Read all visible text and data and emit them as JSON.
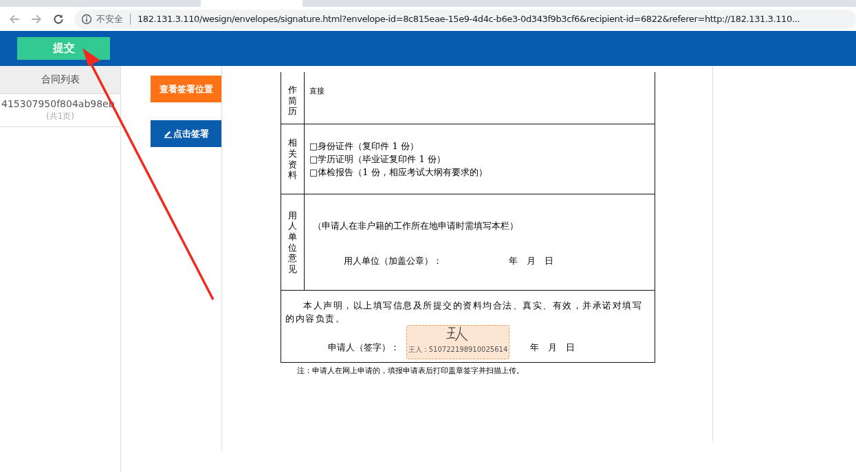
{
  "browser": {
    "security_label": "不安全",
    "url": "182.131.3.110/wesign/envelopes/signature.html?envelope-id=8c815eae-15e9-4d4c-b6e3-0d343f9b3cf6&recipient-id=6822&referer=http://182.131.3.110..."
  },
  "header": {
    "submit_button": "提交"
  },
  "sidebar": {
    "title": "合同列表",
    "items": [
      {
        "name": "415307950f804ab98eb",
        "pages": "(共1页)",
        "selected": false
      }
    ]
  },
  "actions": {
    "view_position_button": "查看签署位置",
    "sign_button": "点击签署"
  },
  "form": {
    "rows": [
      {
        "label": "作简历",
        "kind": "text",
        "lines": [
          "直接"
        ]
      },
      {
        "label": "相关资料",
        "kind": "checklist",
        "lines": [
          "□身份证件（复印件 1 份）",
          "□学历证明（毕业证复印件 1 份）",
          "□体检报告（1 份，相应考试大纲有要求的）"
        ]
      },
      {
        "label": "用人单位意见",
        "kind": "opinion",
        "lines": [
          "（申请人在非户籍的工作所在地申请时需填写本栏）",
          "用人单位（加盖公章）：",
          "年　月　日"
        ]
      }
    ],
    "declaration": {
      "text": "本人声明，以上填写信息及所提交的资料均合法、真实、有效，并承诺对填写的内容负责。",
      "signer_label": "申请人（签字）：",
      "signature_caption": "王人：510722198910025614",
      "date": "年　月　日"
    },
    "note": "注：申请人在网上申请的，填报申请表后打印盖章签字并扫描上传。"
  }
}
